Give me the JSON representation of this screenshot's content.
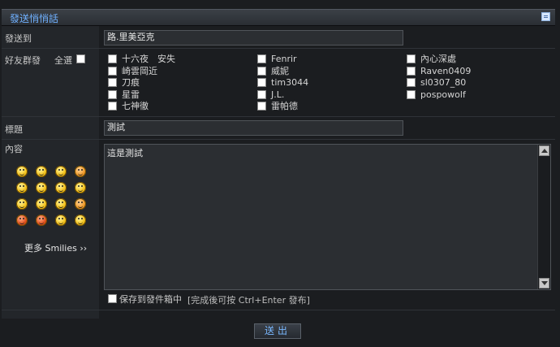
{
  "window": {
    "title": "發送悄悄話"
  },
  "to": {
    "label": "發送到",
    "value": "路.里美亞克"
  },
  "friends": {
    "label": "好友群發",
    "select_all_label": "全選",
    "list": [
      "十六夜　安失",
      "崎雲岡近",
      "刀痕",
      "星雷",
      "七神徹",
      "Fenrir",
      "威妮",
      "tim3044",
      "J.L.",
      "雷帕德",
      "內心深處",
      "Raven0409",
      "sl0307_80",
      "pospowolf"
    ]
  },
  "subject": {
    "label": "標題",
    "value": "測試"
  },
  "content": {
    "label": "內容",
    "value": "這是測試"
  },
  "smilies": {
    "more_label": "更多 Smilies ››"
  },
  "options": {
    "save_label": "保存到發件箱中",
    "hint": "[完成後可按 Ctrl+Enter 發布]"
  },
  "submit": {
    "label": "送出"
  }
}
